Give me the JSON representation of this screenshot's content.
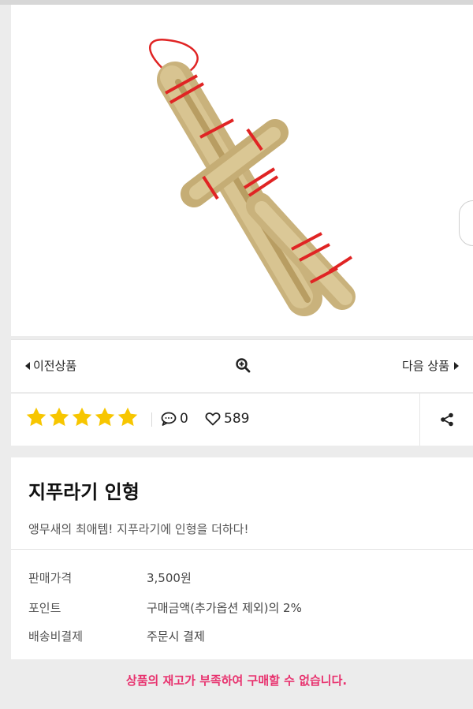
{
  "nav": {
    "prev_label": "이전상품",
    "next_label": "다음 상품"
  },
  "rating": {
    "stars": 5,
    "comment_count": "0",
    "like_count": "589",
    "star_color": "#f7c600"
  },
  "product": {
    "title": "지푸라기 인형",
    "subtitle": "앵무새의 최애템! 지푸라기에 인형을 더하다!",
    "details": [
      {
        "label": "판매가격",
        "value": "3,500원"
      },
      {
        "label": "포인트",
        "value": "구매금액(추가옵션 제외)의 2%"
      },
      {
        "label": "배송비결제",
        "value": "주문시 결제"
      }
    ]
  },
  "stock_message": "상품의 재고가 부족하여 구매할 수 없습니다.",
  "colors": {
    "accent_pink": "#e8336f",
    "straw": "#cdb98a",
    "binding_red": "#e02424"
  },
  "icons": {
    "prev": "caret-left-icon",
    "zoom": "zoom-in-icon",
    "next": "caret-right-icon",
    "comment": "speech-bubble-icon",
    "like": "heart-icon",
    "share": "share-icon"
  }
}
